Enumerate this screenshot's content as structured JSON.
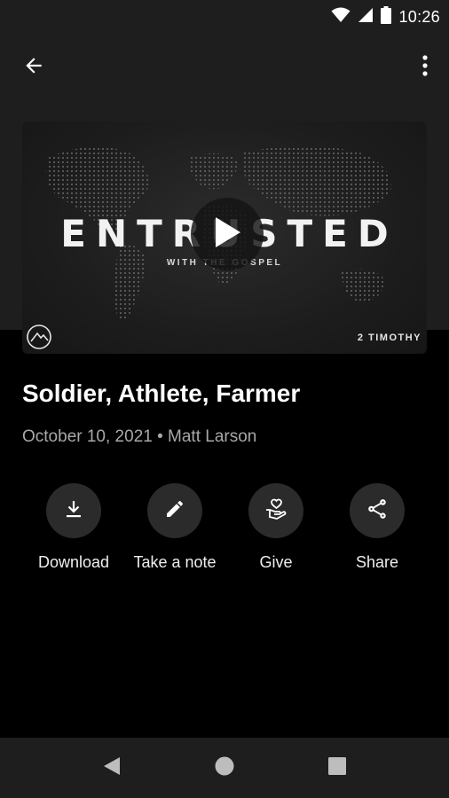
{
  "status_bar": {
    "time": "10:26",
    "icons": [
      "wifi-icon",
      "signal-icon",
      "battery-icon"
    ]
  },
  "app_bar": {
    "back_icon": "arrow-back-icon",
    "more_icon": "more-vert-icon"
  },
  "artwork": {
    "title": "ENTRUSTED",
    "subtitle": "WITH THE GOSPEL",
    "series": "2 TIMOTHY",
    "logo_icon": "mountain-logo-icon",
    "play_icon": "play-icon"
  },
  "sermon": {
    "title": "Soldier, Athlete, Farmer",
    "meta": "October 10, 2021 • Matt Larson"
  },
  "actions": [
    {
      "label": "Download",
      "icon": "download-icon"
    },
    {
      "label": "Take a note",
      "icon": "pencil-icon"
    },
    {
      "label": "Give",
      "icon": "give-hand-heart-icon"
    },
    {
      "label": "Share",
      "icon": "share-icon"
    }
  ],
  "nav_bar": {
    "icons": [
      "back-triangle-icon",
      "home-circle-icon",
      "recents-square-icon"
    ]
  },
  "colors": {
    "background": "#000000",
    "surface": "#1e1e1e",
    "action_circle": "#2b2b2b",
    "meta_text": "#a8a8a8"
  }
}
